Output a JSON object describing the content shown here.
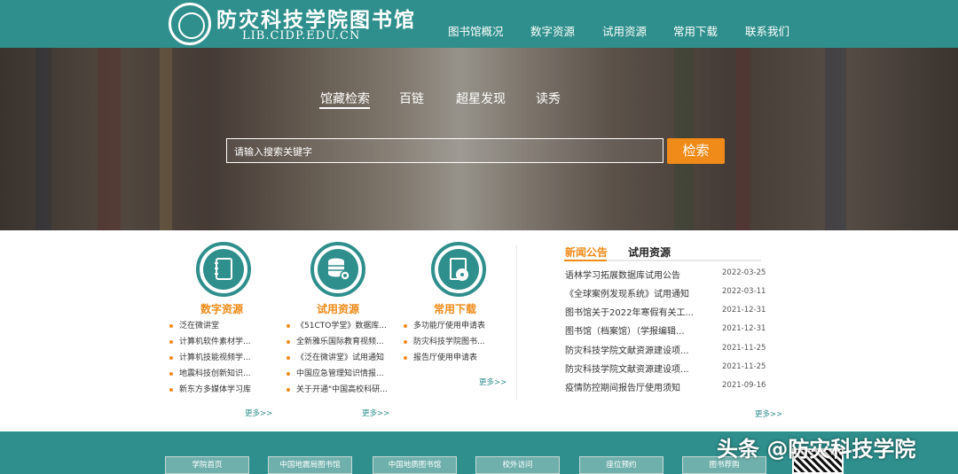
{
  "header": {
    "logo_title": "防灾科技学院图书馆",
    "logo_url": "LIB.CIDP.EDU.CN",
    "nav": [
      "图书馆概况",
      "数字资源",
      "试用资源",
      "常用下载",
      "联系我们"
    ]
  },
  "hero": {
    "tabs": [
      "馆藏检索",
      "百链",
      "超星发现",
      "读秀"
    ],
    "active_tab": "馆藏检索",
    "search_placeholder": "请输入搜索关键字",
    "search_button": "检索"
  },
  "resources": [
    {
      "title": "数字资源",
      "icon": "notebook-icon",
      "items": [
        "泛在微讲堂",
        "计算机软件素材学...",
        "计算机技能视频学...",
        "地震科技创新知识...",
        "新东方多媒体学习库"
      ],
      "more": "更多>>"
    },
    {
      "title": "试用资源",
      "icon": "database-gear-icon",
      "items": [
        "《51CTO学堂》数据库...",
        "全新雅乐国际教育视频...",
        "《泛在微讲堂》试用通知",
        "中国应急管理知识情报...",
        "关于开通\"中国高校科研..."
      ],
      "more": "更多>>"
    },
    {
      "title": "常用下载",
      "icon": "disc-box-icon",
      "items": [
        "多功能厅使用申请表",
        "防灾科技学院图书...",
        "报告厅使用申请表"
      ],
      "more": "更多>>"
    }
  ],
  "news": {
    "tabs": [
      "新闻公告",
      "试用资源"
    ],
    "active_tab": "新闻公告",
    "items": [
      {
        "title": "语林学习拓展数据库试用公告",
        "date": "2022-03-25"
      },
      {
        "title": "《全球案例发现系统》试用通知",
        "date": "2022-03-11"
      },
      {
        "title": "图书馆关于2022年寒假有关工...",
        "date": "2021-12-31"
      },
      {
        "title": "图书馆（档案馆）（学报编辑...",
        "date": "2021-12-31"
      },
      {
        "title": "防灾科技学院文献资源建设项...",
        "date": "2021-11-25"
      },
      {
        "title": "防灾科技学院文献资源建设项...",
        "date": "2021-11-25"
      },
      {
        "title": "疫情防控期间报告厅使用须知",
        "date": "2021-09-16"
      }
    ],
    "more": "更多>>"
  },
  "footer": {
    "links": [
      "学院首页",
      "中国地震局图书馆",
      "中国地质图书馆",
      "校外访问",
      "座位预约",
      "图书荐购"
    ],
    "watermark": "头条 @防灾科技学院"
  },
  "colors": {
    "primary": "#2e8f8c",
    "accent": "#f08a18"
  }
}
